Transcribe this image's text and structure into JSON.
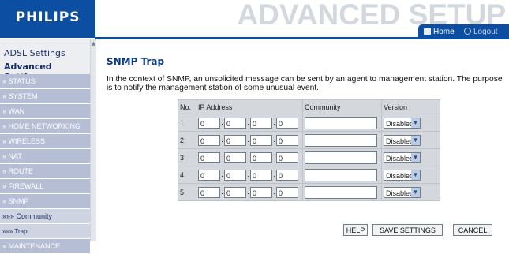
{
  "brand": {
    "logo": "PHILIPS",
    "page_title": "ADVANCED SETUP"
  },
  "top_links": {
    "home": "Home",
    "logout": "Logout"
  },
  "sidebar": {
    "headings": [
      "ADSL Settings",
      "Advanced Settings"
    ],
    "items": [
      "» STATUS",
      "» SYSTEM",
      "» WAN",
      "» HOME NETWORKING",
      "» WIRELESS",
      "» NAT",
      "» ROUTE",
      "» FIREWALL",
      "» SNMP",
      "»»» Community",
      "»»» Trap",
      "» MAINTENANCE"
    ]
  },
  "main": {
    "heading": "SNMP Trap",
    "description": "In the context of SNMP, an unsolicited message can be sent by an agent to management station. The purpose is to notify the management station of some unusual event.",
    "table": {
      "headers": [
        "No.",
        "IP Address",
        "Community",
        "Version"
      ],
      "rows": [
        {
          "no": "1",
          "ip": [
            "0",
            "0",
            "0",
            "0"
          ],
          "community": "",
          "version": "Disabled"
        },
        {
          "no": "2",
          "ip": [
            "0",
            "0",
            "0",
            "0"
          ],
          "community": "",
          "version": "Disabled"
        },
        {
          "no": "3",
          "ip": [
            "0",
            "0",
            "0",
            "0"
          ],
          "community": "",
          "version": "Disabled"
        },
        {
          "no": "4",
          "ip": [
            "0",
            "0",
            "0",
            "0"
          ],
          "community": "",
          "version": "Disabled"
        },
        {
          "no": "5",
          "ip": [
            "0",
            "0",
            "0",
            "0"
          ],
          "community": "",
          "version": "Disabled"
        }
      ]
    },
    "buttons": {
      "help": "HELP",
      "save": "SAVE SETTINGS",
      "cancel": "CANCEL"
    }
  },
  "colors": {
    "brand_blue": "#0b4ea2",
    "sidebar_item": "#b6bed6",
    "table_bg": "#d4d8dd"
  },
  "icons": {
    "home": "home-icon",
    "logout": "logout-icon",
    "dropdown": "chevron-down-icon"
  }
}
